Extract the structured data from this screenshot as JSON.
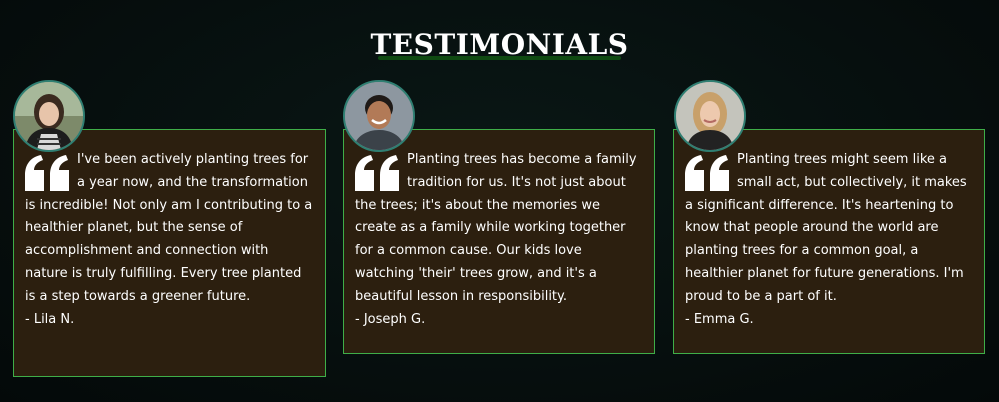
{
  "section": {
    "title": "TESTIMONIALS"
  },
  "testimonials": [
    {
      "quote": "I've been actively planting trees for a year now, and the transformation is incredible! Not only am I contributing to a healthier planet, but the sense of accomplishment and connection with nature is truly fulfilling. Every tree planted is a step towards a greener future.",
      "author": "- Lila N."
    },
    {
      "quote": "Planting trees has become a family tradition for us. It's not just about the trees; it's about the memories we create as a family while working together for a common cause. Our kids love watching 'their' trees grow, and it's a beautiful lesson in responsibility.",
      "author": "- Joseph G."
    },
    {
      "quote": "Planting trees might seem like a small act, but collectively, it makes a significant difference. It's heartening to know that people around the world are planting trees for a common goal, a healthier planet for future generations. I'm proud to be a part of it.",
      "author": "- Emma G."
    }
  ],
  "colors": {
    "background": "#071110",
    "card_background": "#2c1f0f",
    "card_border": "#3fae48",
    "title_underline": "#0f4a12",
    "text": "#ffffff"
  },
  "icons": {
    "quote": "quote-icon",
    "avatar": "avatar"
  }
}
